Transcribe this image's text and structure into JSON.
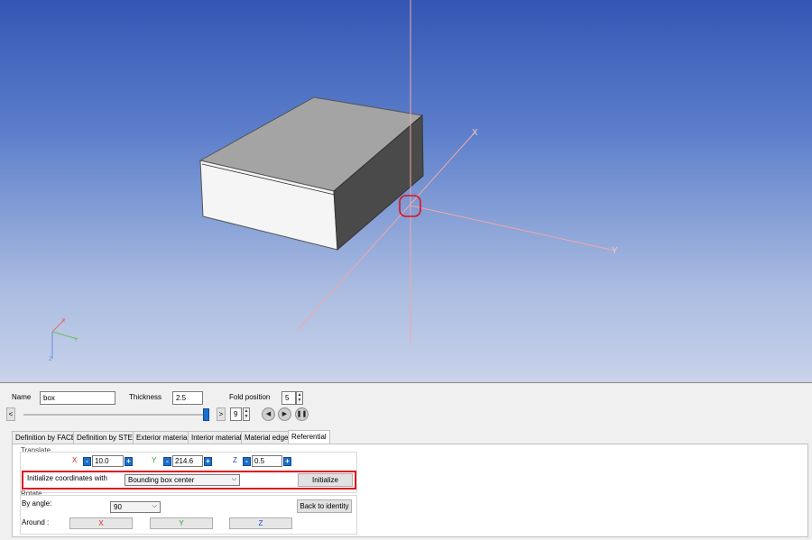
{
  "viewport": {
    "axis_x_label": "X",
    "axis_y_label": "Y",
    "triad_x_label": "X",
    "triad_y_label": "Y",
    "triad_z_label": "Z"
  },
  "header": {
    "name_label": "Name",
    "name_value": "box",
    "thickness_label": "Thickness",
    "thickness_value": "2.5",
    "fold_position_label": "Fold position",
    "fold_position_value": "5",
    "slider_prev": "<",
    "slider_next": ">",
    "frame_value": "9",
    "slider_level": 0.98
  },
  "tabs": [
    {
      "label": "Definition by FACE"
    },
    {
      "label": "Definition by STEP"
    },
    {
      "label": "Exterior material"
    },
    {
      "label": "Interior material"
    },
    {
      "label": "Material edge"
    },
    {
      "label": "Referential"
    }
  ],
  "translate": {
    "title": "Translate",
    "x_label": "X",
    "x_value": "10.0",
    "y_label": "Y",
    "y_value": "214.6",
    "z_label": "Z",
    "z_value": "0.5",
    "minus": "-",
    "plus": "+",
    "init_label": "Initialize coordinates with",
    "init_select": "Bounding box center",
    "init_button": "Initialize"
  },
  "rotate": {
    "title": "Rotate",
    "by_angle_label": "By angle:",
    "angle_value": "90",
    "back_button": "Back to identity",
    "around_label": "Around :",
    "x_button": "X",
    "y_button": "Y",
    "z_button": "Z"
  },
  "colors": {
    "highlight": "#e0101a",
    "axis": "#f2a7a7",
    "x_red": "#e02020",
    "y_green": "#2aa02a",
    "z_blue": "#2040d0"
  }
}
